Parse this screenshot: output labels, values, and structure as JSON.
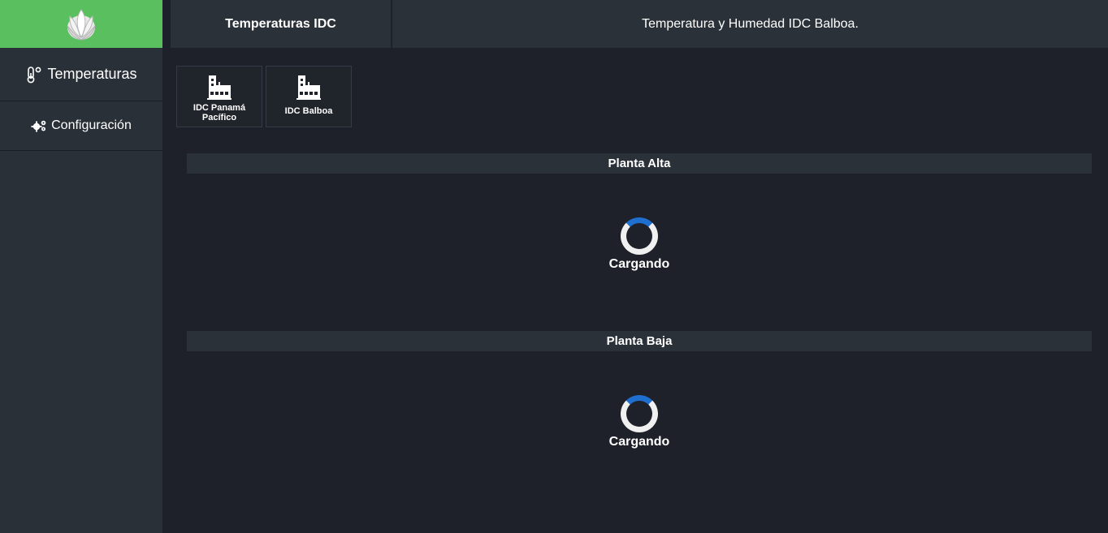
{
  "sidebar": {
    "logo_icon": "liberty-flower-logo",
    "items": [
      {
        "label": "Temperaturas",
        "icon": "thermometer-icon"
      },
      {
        "label": "Configuración",
        "icon": "gears-icon"
      }
    ]
  },
  "header": {
    "tab_label": "Temperaturas IDC",
    "title": "Temperatura y Humedad IDC Balboa."
  },
  "sites": [
    {
      "label": "IDC Panamá Pacífico",
      "icon": "factory-icon"
    },
    {
      "label": "IDC Balboa",
      "icon": "factory-icon"
    }
  ],
  "sections": [
    {
      "title": "Planta Alta",
      "loading_text": "Cargando"
    },
    {
      "title": "Planta Baja",
      "loading_text": "Cargando"
    }
  ],
  "colors": {
    "brand_green": "#5ac05f",
    "sidebar_bg": "#2a3038",
    "content_bg": "#1e2129",
    "spinner_accent": "#1f6fce"
  }
}
